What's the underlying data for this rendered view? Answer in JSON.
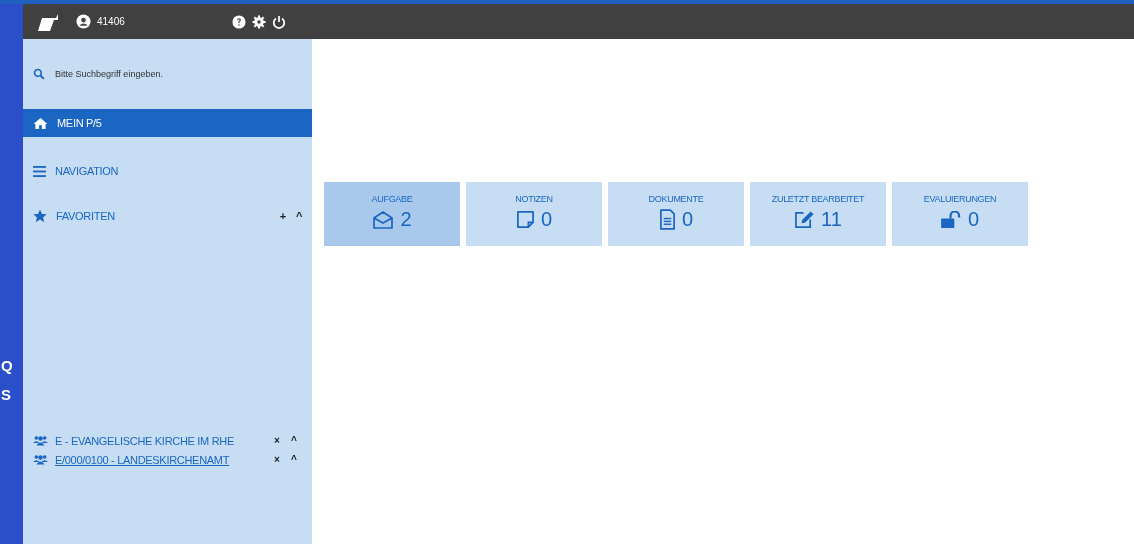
{
  "header": {
    "user": "41406"
  },
  "edge_letters": [
    "Q",
    "S"
  ],
  "search": {
    "placeholder": "Bitte Suchbegriff eingeben."
  },
  "nav": [
    {
      "kind": "home",
      "label": "MEIN P/5",
      "selected": true
    },
    {
      "kind": "menu",
      "label": "NAVIGATION",
      "selected": false
    },
    {
      "kind": "star",
      "label": "FAVORITEN",
      "selected": false,
      "actions": [
        "+",
        "^"
      ]
    }
  ],
  "groups": [
    {
      "label": "E - EVANGELISCHE KIRCHE IM RHE",
      "underlined": false,
      "actions": [
        "×",
        "^"
      ]
    },
    {
      "label": "E/000/0100 - LANDESKIRCHENAMT",
      "underlined": true,
      "actions": [
        "×",
        "^"
      ]
    }
  ],
  "tiles": [
    {
      "kind": "envelope",
      "title": "AUFGABE",
      "count": "2",
      "selected": true
    },
    {
      "kind": "note",
      "title": "NOTIZEN",
      "count": "0",
      "selected": false
    },
    {
      "kind": "document",
      "title": "DOKUMENTE",
      "count": "0",
      "selected": false
    },
    {
      "kind": "edit",
      "title": "ZULETZT BEARBEITET",
      "count": "11",
      "selected": false
    },
    {
      "kind": "unlock",
      "title": "EVALUIERUNGEN",
      "count": "0",
      "selected": false
    }
  ]
}
